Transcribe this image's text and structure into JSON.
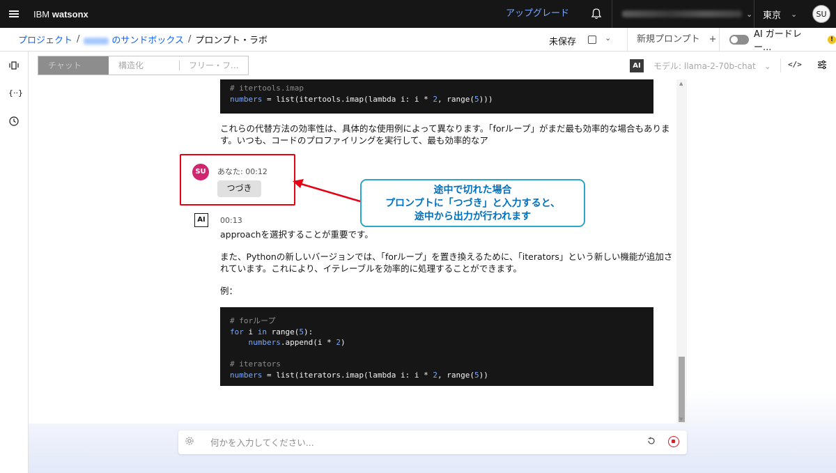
{
  "topbar": {
    "brand_prefix": "IBM ",
    "brand_name": "watsonx",
    "upgrade_label": "アップグレード",
    "region_label": "東京",
    "avatar_initials": "SU"
  },
  "breadcrumb": {
    "projects_label": "プロジェクト",
    "sandbox_label": "のサンドボックス",
    "current_label": "プロンプト・ラボ",
    "separator": "/"
  },
  "actions": {
    "unsaved_label": "未保存",
    "new_prompt_label": "新規プロンプト　+",
    "ai_guardrails_label": "AI ガードレー...",
    "warning_glyph": "!"
  },
  "toolbar": {
    "tabs": [
      {
        "label": "チャット",
        "active": true
      },
      {
        "label": "構造化",
        "active": false
      },
      {
        "label": "フリー・フ...",
        "active": false
      }
    ],
    "ai_badge": "AI",
    "model_label": "モデル: llama-2-70b-chat　⌄"
  },
  "chat": {
    "code_block_1": {
      "lines": [
        {
          "type": "comment",
          "text": "# itertools.imap"
        },
        {
          "type": "code",
          "parts": [
            {
              "k": "kw",
              "t": "numbers"
            },
            {
              "k": "",
              "t": " = list(itertools.imap(lambda i: i * "
            },
            {
              "k": "num",
              "t": "2"
            },
            {
              "k": "",
              "t": ", range("
            },
            {
              "k": "num",
              "t": "5"
            },
            {
              "k": "",
              "t": ")))"
            }
          ]
        }
      ]
    },
    "ai_text_1_line1": "これらの代替方法の効率性は、具体的な使用例によって異なります。「forループ」がまだ最も効率的な場合もありま",
    "ai_text_1_line2": "す。いつも、コードのプロファイリングを実行して、最も効率的なア",
    "user_message": {
      "avatar": "SU",
      "meta": "あなた: 00:12",
      "text": "つづき"
    },
    "ai_message": {
      "badge": "AI",
      "time": "00:13",
      "line1": "approachを選択することが重要です。",
      "line2": "また、Pythonの新しいバージョンでは、「forループ」を置き換えるために、「iterators」という新しい機能が追加さ",
      "line3": "れています。これにより、イテレーブルを効率的に処理することができます。",
      "line4": "例："
    },
    "code_block_2": {
      "lines": [
        {
          "type": "comment",
          "text": "# forループ"
        },
        {
          "type": "code",
          "parts": [
            {
              "k": "kw",
              "t": "for"
            },
            {
              "k": "",
              "t": " i "
            },
            {
              "k": "kw",
              "t": "in"
            },
            {
              "k": "",
              "t": " range("
            },
            {
              "k": "num",
              "t": "5"
            },
            {
              "k": "",
              "t": "):"
            }
          ]
        },
        {
          "type": "code",
          "parts": [
            {
              "k": "",
              "t": "    "
            },
            {
              "k": "kw",
              "t": "numbers"
            },
            {
              "k": "",
              "t": ".append(i * "
            },
            {
              "k": "num",
              "t": "2"
            },
            {
              "k": "",
              "t": ")"
            }
          ]
        },
        {
          "type": "blank",
          "text": ""
        },
        {
          "type": "comment",
          "text": "# iterators"
        },
        {
          "type": "code",
          "parts": [
            {
              "k": "kw",
              "t": "numbers"
            },
            {
              "k": "",
              "t": " = list(iterators.imap(lambda i: i * "
            },
            {
              "k": "num",
              "t": "2"
            },
            {
              "k": "",
              "t": ", range("
            },
            {
              "k": "num",
              "t": "5"
            },
            {
              "k": "",
              "t": "))"
            }
          ]
        }
      ]
    }
  },
  "annotation": {
    "line1": "途中で切れた場合",
    "line2": "プロンプトに「つづき」と入力すると、",
    "line3": "途中から出力が行われます",
    "border_color": "#2aa6c8",
    "text_color": "#0071c1",
    "highlight_color": "#e60012"
  },
  "input": {
    "placeholder": "何かを入力してください..."
  }
}
